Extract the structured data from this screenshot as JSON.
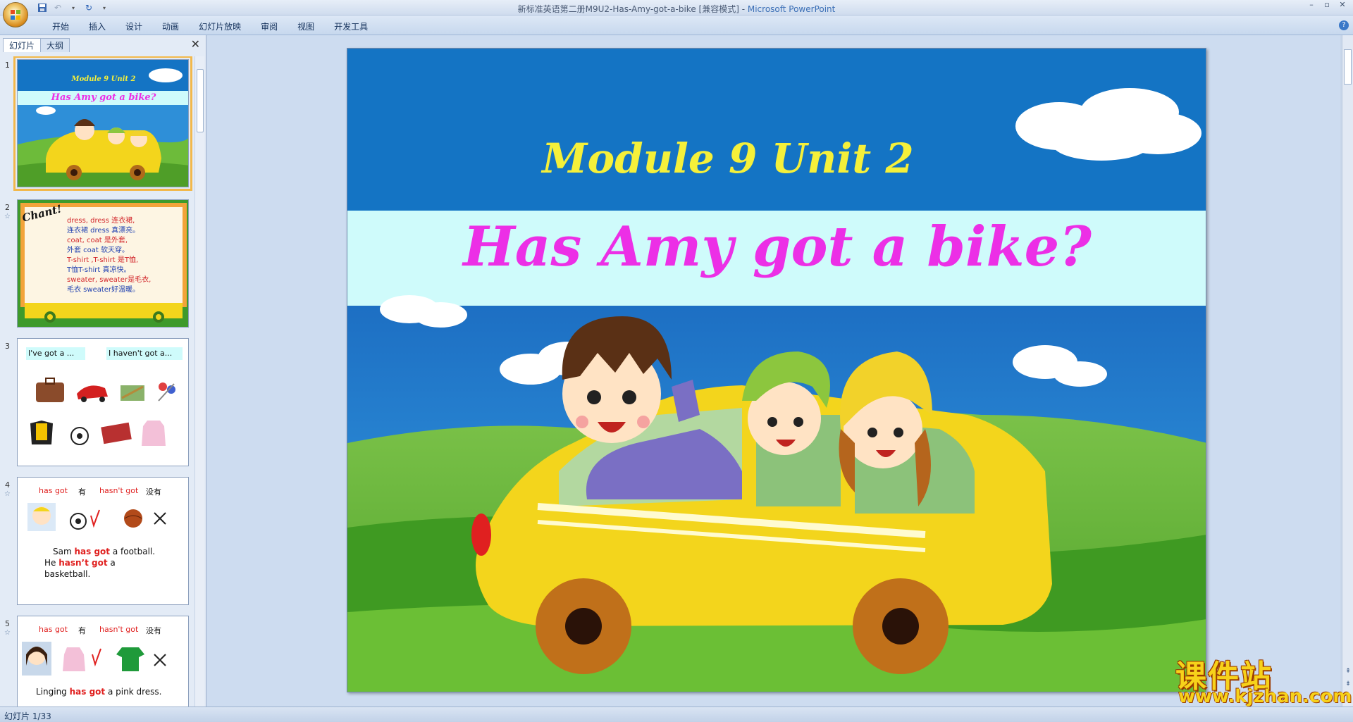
{
  "window": {
    "title_doc": "新标准英语第二册M9U2-Has-Amy-got-a-bike [兼容模式]",
    "title_sep": " - ",
    "title_app": "Microsoft PowerPoint"
  },
  "ribbon": {
    "tabs": [
      "开始",
      "插入",
      "设计",
      "动画",
      "幻灯片放映",
      "审阅",
      "视图",
      "开发工具"
    ]
  },
  "pane": {
    "tabs": [
      "幻灯片",
      "大纲"
    ]
  },
  "thumbnails": [
    {
      "num": "1",
      "module": "Module 9 Unit 2",
      "title": "Has Amy  got a bike?"
    },
    {
      "num": "2",
      "chant": "Chant!",
      "lines": [
        "dress, dress 连衣裙,",
        "连衣裙 dress 真漂亮。",
        "coat, coat 是外套,",
        "外套 coat 软天穿。",
        "T-shirt ,T-shirt 是T恤,",
        "T恤T-shirt 真凉快。",
        "sweater, sweater是毛衣,",
        "毛衣 sweater好温暖。"
      ]
    },
    {
      "num": "3",
      "left_label": "I've got a ...",
      "right_label": "I haven't got a..."
    },
    {
      "num": "4",
      "has": "has got",
      "has_cn": "有",
      "hasnt": "hasn't got",
      "hasnt_cn": "没有",
      "sentence1_a": "Sam ",
      "sentence1_b": "has got",
      "sentence1_c": " a football.",
      "sentence2_a": "He ",
      "sentence2_b": "hasn’t got",
      "sentence2_c": " a",
      "sentence3": "basketball."
    },
    {
      "num": "5",
      "has": "has got",
      "has_cn": "有",
      "hasnt": "hasn't got",
      "hasnt_cn": "没有",
      "sentence1_a": "Linging ",
      "sentence1_b": "has got",
      "sentence1_c": " a pink dress."
    }
  ],
  "slide": {
    "module": "Module 9 Unit 2",
    "title": "Has Amy  got a bike?"
  },
  "status": {
    "text": "幻灯片 1/33"
  },
  "watermark": {
    "cn": "课件站",
    "url": "www.kjzhan.com"
  },
  "colors": {
    "sky": "#1474c4",
    "title_band": "#cffbfb",
    "module_text": "#f5f03a",
    "title_text": "#ec2fe6",
    "grass": "#5bb22f",
    "car": "#f3d51c"
  }
}
